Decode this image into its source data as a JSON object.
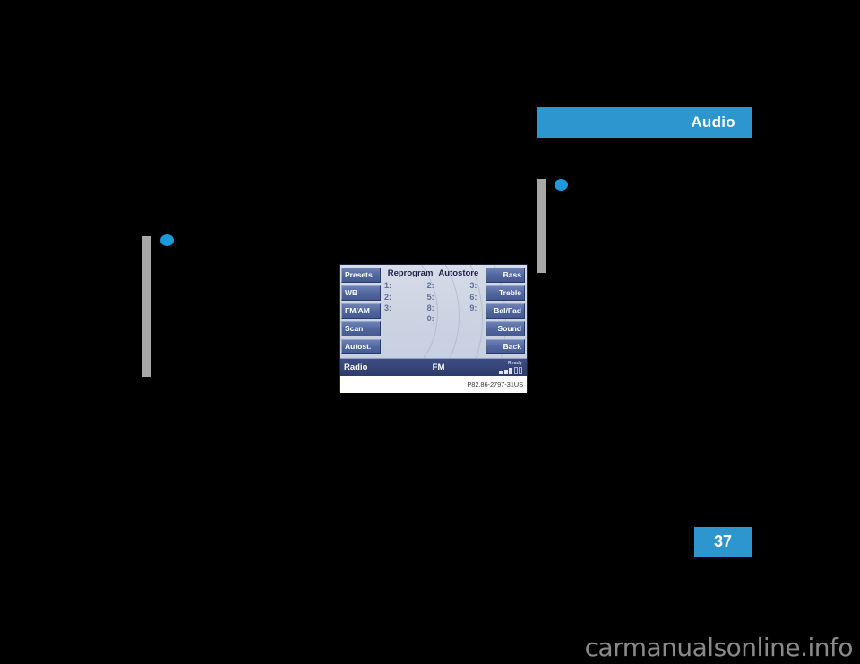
{
  "section_header": {
    "title": "Audio"
  },
  "page_number": {
    "value": "37"
  },
  "figure": {
    "caption": "P82.86-2797-31US",
    "display": {
      "softkeys_left": [
        {
          "label": "Presets"
        },
        {
          "label": "WB"
        },
        {
          "label": "FM/AM"
        },
        {
          "label": "Scan"
        },
        {
          "label": "Autost."
        }
      ],
      "softkeys_right": [
        {
          "label": "Bass"
        },
        {
          "label": "Treble"
        },
        {
          "label": "Bal/Fad"
        },
        {
          "label": "Sound"
        },
        {
          "label": "Back"
        }
      ],
      "center_headings": [
        {
          "label": "Reprogram"
        },
        {
          "label": "Autostore"
        }
      ],
      "presets": [
        {
          "c1": "1:",
          "c2": "2:",
          "c3": "3:"
        },
        {
          "c1": "2:",
          "c2": "5:",
          "c3": "6:"
        },
        {
          "c1": "3:",
          "c2": "8:",
          "c3": "9:"
        },
        {
          "c1": "",
          "c2": "0:",
          "c3": ""
        }
      ],
      "status": {
        "source": "Radio",
        "band": "FM",
        "ready_label": "Ready"
      }
    }
  },
  "watermark": {
    "text": "carmanualsonline.info"
  },
  "colors": {
    "accent_blue": "#2e96ce",
    "bullet_blue": "#1a9ada",
    "rule_gray": "#a8a8a8",
    "page_background": "#000000",
    "softkey_blue": "#51679f",
    "status_bar_blue": "#354475"
  }
}
